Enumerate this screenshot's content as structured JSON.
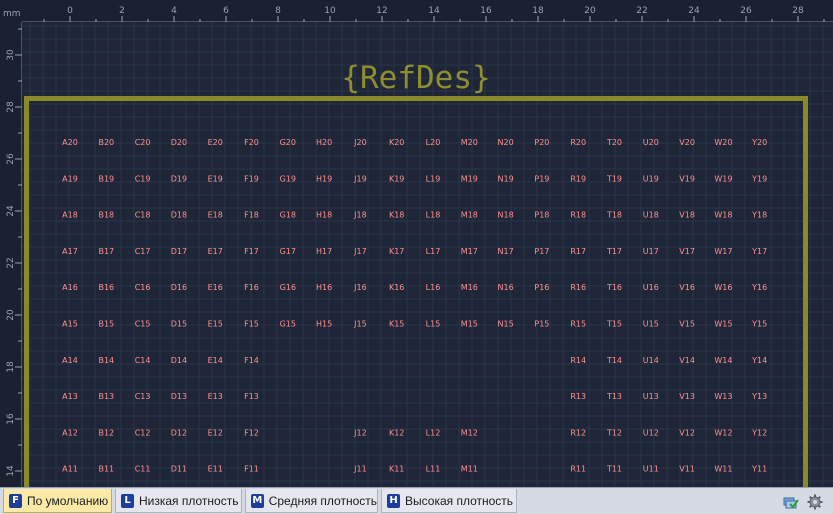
{
  "ruler": {
    "unit_label": "mm",
    "top_ticks": [
      "0",
      "2",
      "4",
      "6",
      "8",
      "10",
      "12",
      "14",
      "16",
      "18",
      "20",
      "22",
      "24",
      "26",
      "28"
    ],
    "left_ticks": [
      "30",
      "28",
      "26",
      "24",
      "22",
      "20",
      "18",
      "16",
      "14"
    ]
  },
  "component": {
    "refdes_label": "{RefDes}"
  },
  "pads": {
    "columns": [
      "A",
      "B",
      "C",
      "D",
      "E",
      "F",
      "G",
      "H",
      "J",
      "K",
      "L",
      "M",
      "N",
      "P",
      "R",
      "T",
      "U",
      "V",
      "W",
      "Y"
    ],
    "rows": [
      {
        "num": "20",
        "present": [
          "A",
          "B",
          "C",
          "D",
          "E",
          "F",
          "G",
          "H",
          "J",
          "K",
          "L",
          "M",
          "N",
          "P",
          "R",
          "T",
          "U",
          "V",
          "W",
          "Y"
        ]
      },
      {
        "num": "19",
        "present": [
          "A",
          "B",
          "C",
          "D",
          "E",
          "F",
          "G",
          "H",
          "J",
          "K",
          "L",
          "M",
          "N",
          "P",
          "R",
          "T",
          "U",
          "V",
          "W",
          "Y"
        ]
      },
      {
        "num": "18",
        "present": [
          "A",
          "B",
          "C",
          "D",
          "E",
          "F",
          "G",
          "H",
          "J",
          "K",
          "L",
          "M",
          "N",
          "P",
          "R",
          "T",
          "U",
          "V",
          "W",
          "Y"
        ]
      },
      {
        "num": "17",
        "present": [
          "A",
          "B",
          "C",
          "D",
          "E",
          "F",
          "G",
          "H",
          "J",
          "K",
          "L",
          "M",
          "N",
          "P",
          "R",
          "T",
          "U",
          "V",
          "W",
          "Y"
        ]
      },
      {
        "num": "16",
        "present": [
          "A",
          "B",
          "C",
          "D",
          "E",
          "F",
          "G",
          "H",
          "J",
          "K",
          "L",
          "M",
          "N",
          "P",
          "R",
          "T",
          "U",
          "V",
          "W",
          "Y"
        ]
      },
      {
        "num": "15",
        "present": [
          "A",
          "B",
          "C",
          "D",
          "E",
          "F",
          "G",
          "H",
          "J",
          "K",
          "L",
          "M",
          "N",
          "P",
          "R",
          "T",
          "U",
          "V",
          "W",
          "Y"
        ]
      },
      {
        "num": "14",
        "present": [
          "A",
          "B",
          "C",
          "D",
          "E",
          "F",
          "R",
          "T",
          "U",
          "V",
          "W",
          "Y"
        ]
      },
      {
        "num": "13",
        "present": [
          "A",
          "B",
          "C",
          "D",
          "E",
          "F",
          "R",
          "T",
          "U",
          "V",
          "W",
          "Y"
        ]
      },
      {
        "num": "12",
        "present": [
          "A",
          "B",
          "C",
          "D",
          "E",
          "F",
          "J",
          "K",
          "L",
          "M",
          "R",
          "T",
          "U",
          "V",
          "W",
          "Y"
        ]
      },
      {
        "num": "11",
        "present": [
          "A",
          "B",
          "C",
          "D",
          "E",
          "F",
          "J",
          "K",
          "L",
          "M",
          "R",
          "T",
          "U",
          "V",
          "W",
          "Y"
        ]
      }
    ]
  },
  "tabs": [
    {
      "icon": "F",
      "label": "По умолчанию",
      "active": true
    },
    {
      "icon": "L",
      "label": "Низкая плотность",
      "active": false
    },
    {
      "icon": "M",
      "label": "Средняя плотность",
      "active": false
    },
    {
      "icon": "H",
      "label": "Высокая плотность",
      "active": false
    }
  ],
  "colors": {
    "background": "#1e2638",
    "grid": "#2c3547",
    "outline": "#8a8a2a",
    "refdes": "#8e8e30",
    "pad_text": "#ff9090",
    "tab_active": "#fbe9a8",
    "tab_icon": "#1c3e9c"
  },
  "tools": [
    {
      "icon": "layers-check-icon"
    },
    {
      "icon": "gear-icon"
    }
  ]
}
